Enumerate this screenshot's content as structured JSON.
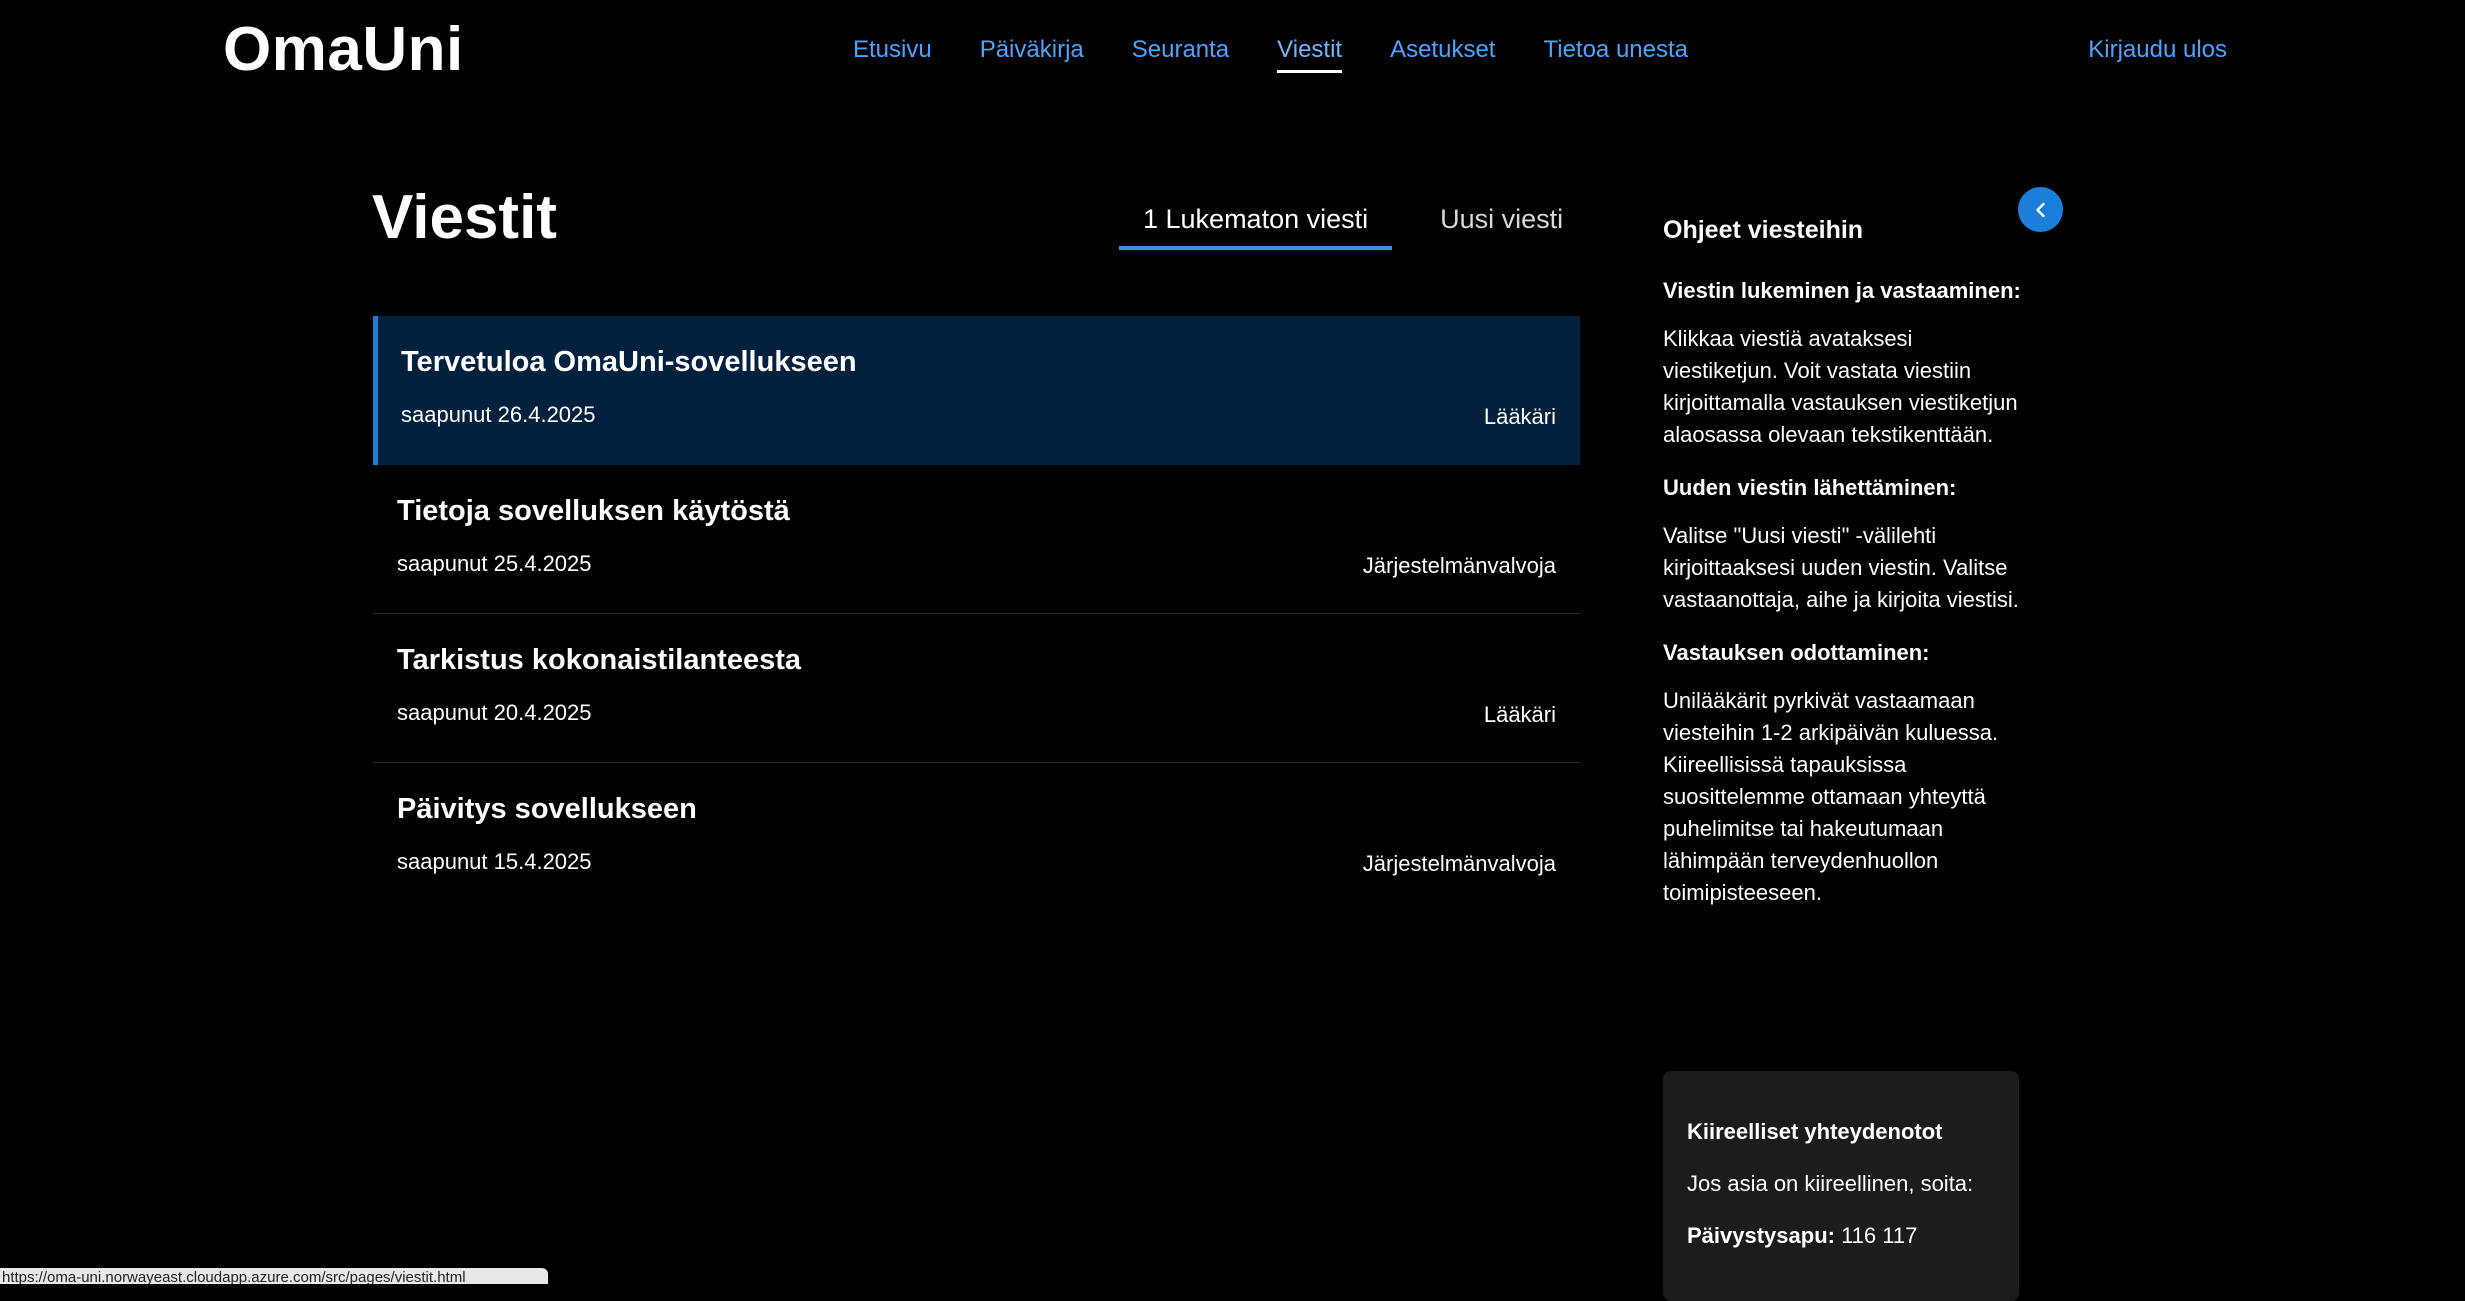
{
  "header": {
    "logo": "OmaUni",
    "nav": [
      {
        "label": "Etusivu",
        "active": false
      },
      {
        "label": "Päiväkirja",
        "active": false
      },
      {
        "label": "Seuranta",
        "active": false
      },
      {
        "label": "Viestit",
        "active": true
      },
      {
        "label": "Asetukset",
        "active": false
      },
      {
        "label": "Tietoa unesta",
        "active": false
      }
    ],
    "logout": "Kirjaudu ulos"
  },
  "main": {
    "title": "Viestit",
    "tabs": [
      {
        "label": "1 Lukematon viesti",
        "active": true
      },
      {
        "label": "Uusi viesti",
        "active": false
      }
    ],
    "messages": [
      {
        "subject": "Tervetuloa OmaUni-sovellukseen",
        "date": "saapunut 26.4.2025",
        "sender": "Lääkäri",
        "selected": true
      },
      {
        "subject": "Tietoja sovelluksen käytöstä",
        "date": "saapunut 25.4.2025",
        "sender": "Järjestelmänvalvoja",
        "selected": false
      },
      {
        "subject": "Tarkistus kokonaistilanteesta",
        "date": "saapunut 20.4.2025",
        "sender": "Lääkäri",
        "selected": false
      },
      {
        "subject": "Päivitys sovellukseen",
        "date": "saapunut 15.4.2025",
        "sender": "Järjestelmänvalvoja",
        "selected": false
      }
    ]
  },
  "sidebar": {
    "title": "Ohjeet viesteihin",
    "sections": [
      {
        "heading": "Viestin lukeminen ja vastaaminen:",
        "text": "Klikkaa viestiä avataksesi viestiketjun. Voit vastata viestiin kirjoittamalla vastauksen viestiketjun alaosassa olevaan tekstikenttään."
      },
      {
        "heading": "Uuden viestin lähettäminen:",
        "text": "Valitse \"Uusi viesti\" -välilehti kirjoittaaksesi uuden viestin. Valitse vastaanottaja, aihe ja kirjoita viestisi."
      },
      {
        "heading": "Vastauksen odottaminen:",
        "text": "Unilääkärit pyrkivät vastaamaan viesteihin 1-2 arkipäivän kuluessa. Kiireellisissä tapauksissa suosittelemme ottamaan yhteyttä puhelimitse tai hakeutumaan lähimpään terveydenhuollon toimipisteeseen."
      }
    ],
    "urgent": {
      "title": "Kiireelliset yhteydenotot",
      "line": "Jos asia on kiireellinen, soita:",
      "phone_label": "Päivystysapu:",
      "phone_number": " 116 117"
    }
  },
  "statusbar": {
    "url": "https://oma-uni.norwayeast.cloudapp.azure.com/src/pages/viestit.html"
  },
  "colors": {
    "background": "#000000",
    "link": "#4da3ff",
    "accent": "#1a7fd9",
    "selected_row": "#02213f",
    "panel": "#1c1c1c"
  }
}
